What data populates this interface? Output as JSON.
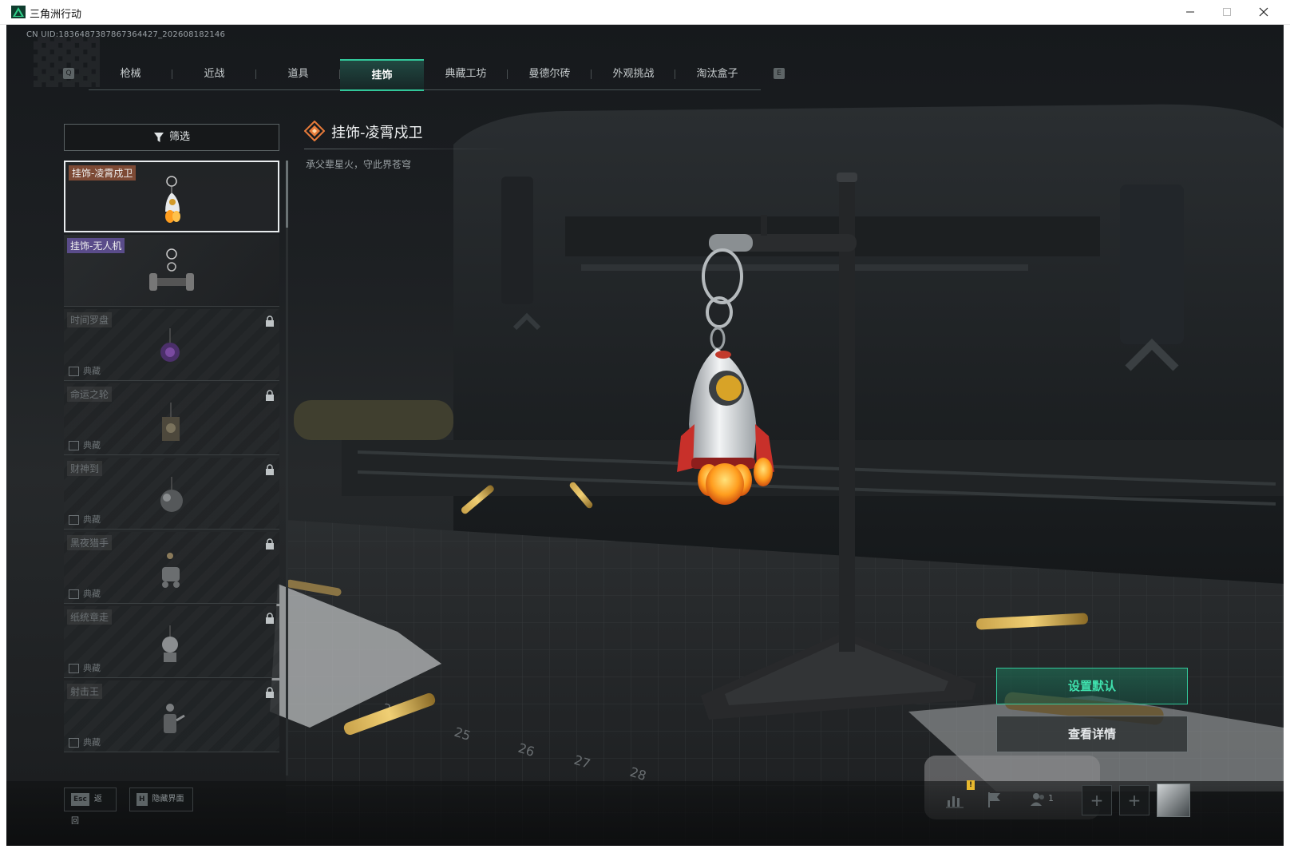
{
  "window": {
    "title": "三角洲行动"
  },
  "uid": "CN UID:1836487387867364427_202608182146",
  "tabs": [
    {
      "label": "枪械"
    },
    {
      "label": "近战"
    },
    {
      "label": "道具"
    },
    {
      "label": "挂饰"
    },
    {
      "label": "典藏工坊"
    },
    {
      "label": "曼德尔砖"
    },
    {
      "label": "外观挑战"
    },
    {
      "label": "淘汰盒子"
    }
  ],
  "tab_keys": {
    "prev": "Q",
    "next": "E"
  },
  "filter": {
    "label": "筛选"
  },
  "items": [
    {
      "name": "挂饰-凌霄戍卫"
    },
    {
      "name": "挂饰-无人机"
    },
    {
      "name": "时间罗盘",
      "rarity": "典藏"
    },
    {
      "name": "命运之轮",
      "rarity": "典藏"
    },
    {
      "name": "财神到",
      "rarity": "典藏"
    },
    {
      "name": "黑夜猎手",
      "rarity": "典藏"
    },
    {
      "name": "纸统章走",
      "rarity": "典藏"
    },
    {
      "name": "射击王",
      "rarity": "典藏"
    }
  ],
  "detail": {
    "title": "挂饰-凌霄戍卫",
    "description": "承父辈星火，守此界苍穹"
  },
  "actions": {
    "set_default": "设置默认",
    "view_detail": "查看详情"
  },
  "bottom": {
    "esc_key": "Esc",
    "esc_label": "返回",
    "h_key": "H",
    "h_label": "隐藏界面",
    "party_count": "1",
    "alert": "!",
    "slot_plus": "+"
  },
  "colors": {
    "accent": "#32c79a",
    "selected_rarity": "#7d4a35",
    "purple_rarity": "#5a4c8a"
  }
}
